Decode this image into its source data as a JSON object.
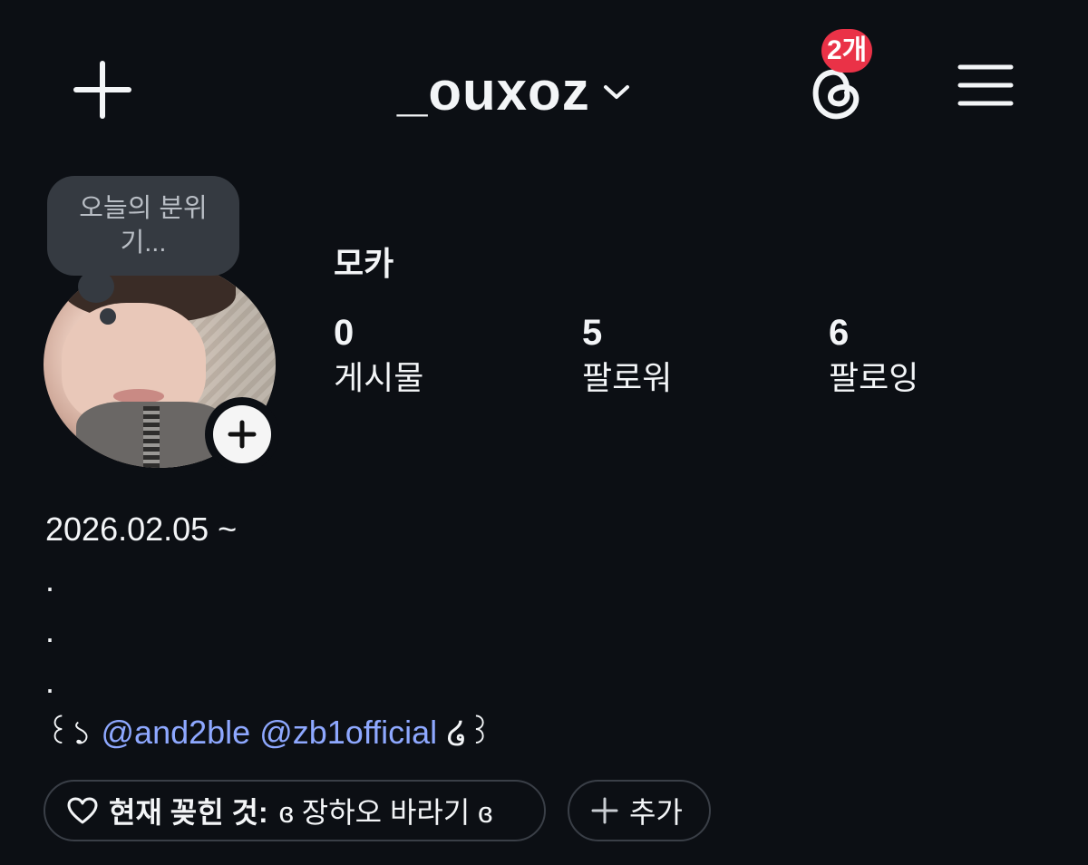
{
  "header": {
    "username": "_ouxoz",
    "threads_badge": "2개"
  },
  "profile": {
    "note": "오늘의 분위기...",
    "display_name": "모카",
    "stats": [
      {
        "value": "0",
        "label": "게시물"
      },
      {
        "value": "5",
        "label": "팔로워"
      },
      {
        "value": "6",
        "label": "팔로잉"
      }
    ]
  },
  "bio": {
    "line1": "2026.02.05 ~",
    "dots": [
      ".",
      ".",
      "."
    ],
    "deco_left": "꒰১",
    "mention1": "@and2ble",
    "mention2": "@zb1official",
    "deco_right": "໒꒱"
  },
  "chips": {
    "interest_label": "현재 꽂힌 것:",
    "interest_value": "ɞ 장하오 바라기 ɞ",
    "add_label": "추가"
  },
  "colors": {
    "background": "#0c0f14",
    "mention": "#8ea8ff",
    "badge": "#ea3247"
  },
  "icons": [
    "plus-icon",
    "chevron-down-icon",
    "threads-icon",
    "hamburger-menu-icon",
    "heart-icon"
  ]
}
